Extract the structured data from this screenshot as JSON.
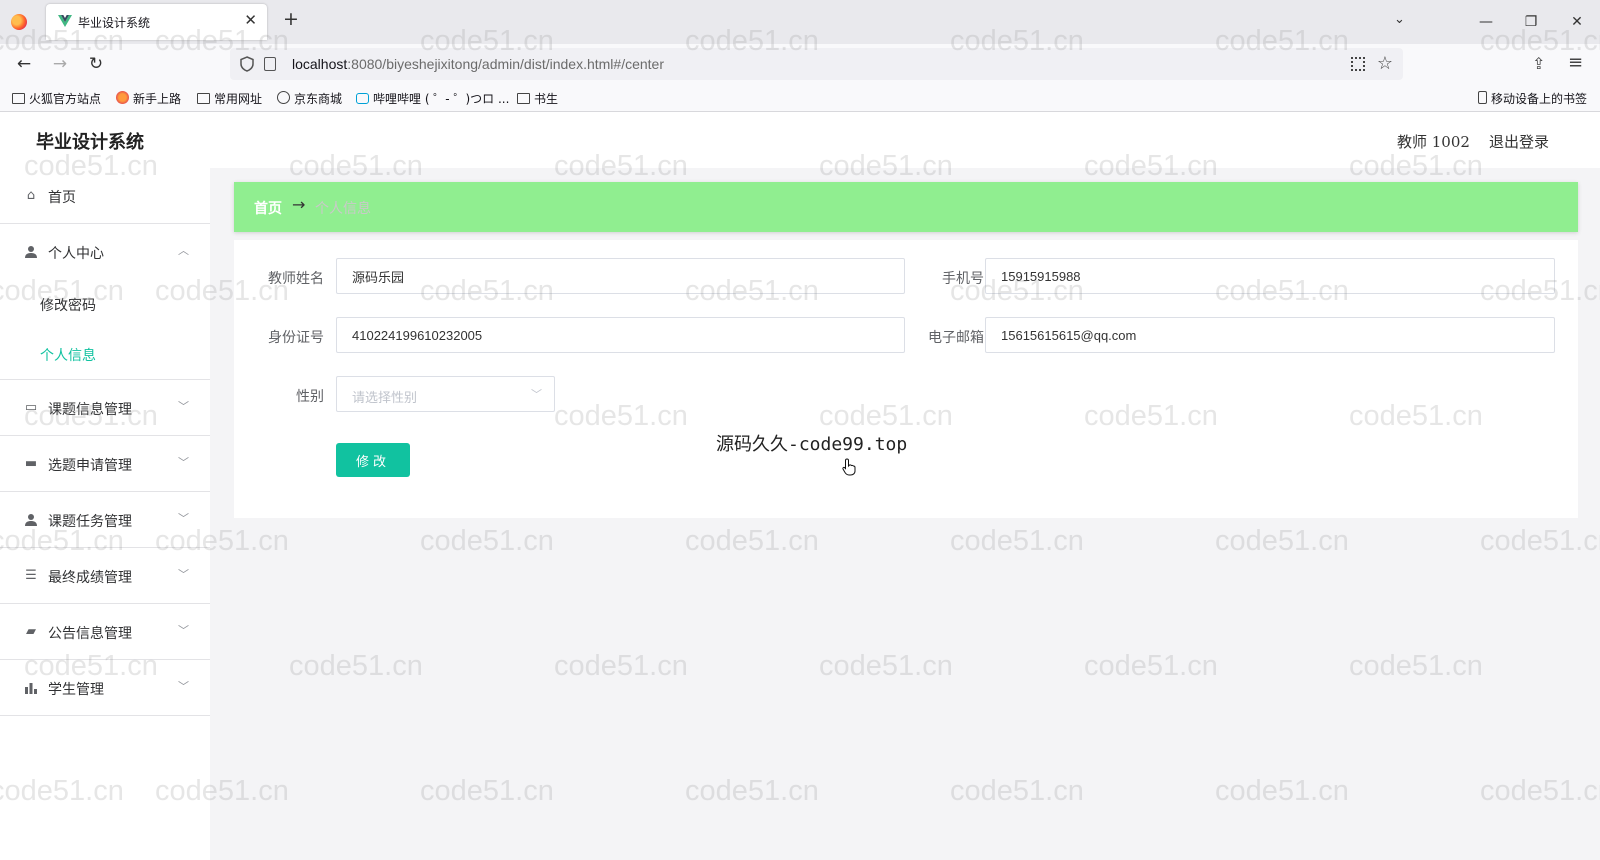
{
  "browser": {
    "tab_title": "毕业设计系统",
    "url_host": "localhost",
    "url_rest": ":8080/biyeshejixitong/admin/dist/index.html#/center",
    "bookmarks": [
      "火狐官方站点",
      "新手上路",
      "常用网址",
      "京东商城",
      "哔哩哔哩 ( ゜- ゜)つロ ...",
      "书生"
    ],
    "mobile_bookmarks": "移动设备上的书签"
  },
  "header": {
    "title": "毕业设计系统",
    "user": "教师 1002",
    "logout": "退出登录"
  },
  "sidebar": {
    "home": "首页",
    "personal_center": "个人中心",
    "sub_items": [
      "修改密码",
      "个人信息"
    ],
    "menus": [
      "课题信息管理",
      "选题申请管理",
      "课题任务管理",
      "最终成绩管理",
      "公告信息管理",
      "学生管理"
    ]
  },
  "breadcrumb": {
    "home": "首页",
    "separator": "→",
    "current": "个人信息"
  },
  "form": {
    "name_label": "教师姓名",
    "name_value": "源码乐园",
    "phone_label": "手机号",
    "phone_value": "15915915988",
    "id_label": "身份证号",
    "id_value": "410224199610232005",
    "email_label": "电子邮箱",
    "email_value": "15615615615@qq.com",
    "gender_label": "性别",
    "gender_placeholder": "请选择性别",
    "submit_label": "修改"
  },
  "overlay_text": "源码久久-code99.top",
  "watermark_text": "code51.cn",
  "colors": {
    "accent": "#11c2a0",
    "breadcrumb_bg": "#90ee90"
  }
}
